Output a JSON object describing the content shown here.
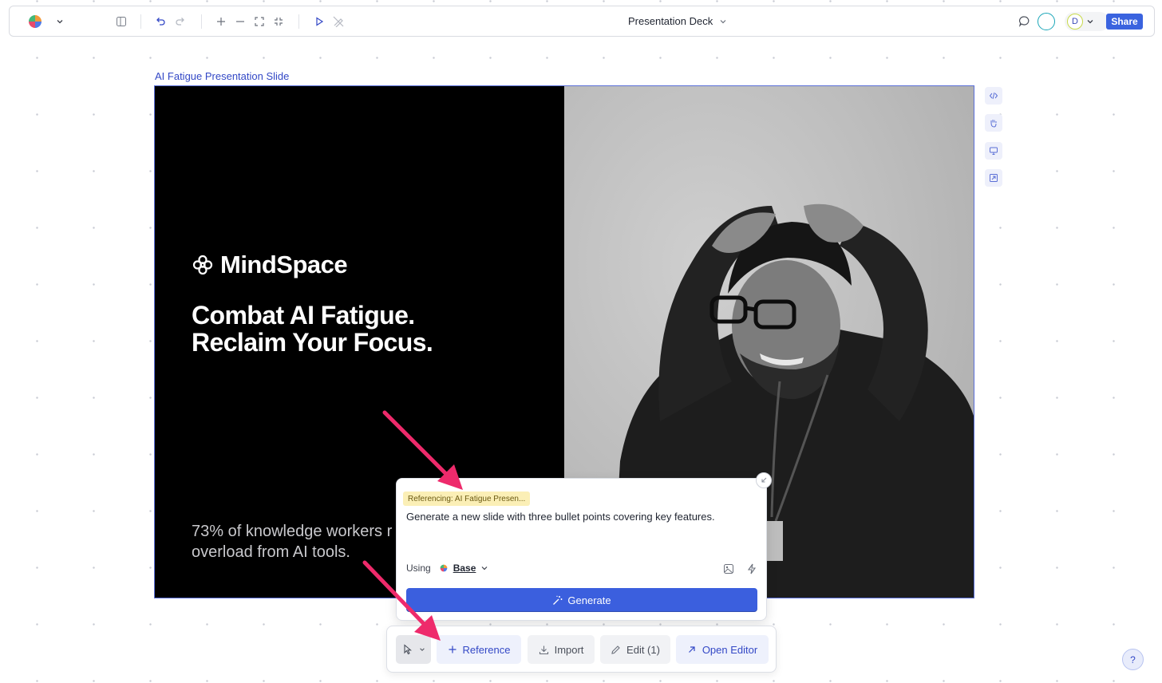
{
  "topbar": {
    "title": "Presentation Deck",
    "share_label": "Share",
    "user_initial": "D"
  },
  "frame": {
    "label": "AI Fatigue Presentation Slide"
  },
  "slide": {
    "brand": "MindSpace",
    "headline_line1": "Combat AI Fatigue.",
    "headline_line2": "Reclaim Your Focus.",
    "stat_line1": "73% of knowledge workers r",
    "stat_line2": "overload from AI tools."
  },
  "side_tools": [
    "code-icon",
    "hand-icon",
    "monitor-icon",
    "expand-icon"
  ],
  "prompt_popup": {
    "reference_chip": "Referencing: AI Fatigue Presen...",
    "prompt": "Generate a new slide with three bullet points covering key features.",
    "using_label": "Using",
    "model": "Base",
    "generate_label": "Generate"
  },
  "bottom_toolbar": {
    "reference_label": "Reference",
    "import_label": "Import",
    "edit_label": "Edit (1)",
    "open_editor_label": "Open Editor"
  },
  "help_label": "?",
  "colors": {
    "accent": "#3b5fde",
    "annotation_arrow": "#ee2a6b",
    "reference_chip_bg": "#fbefb6"
  }
}
